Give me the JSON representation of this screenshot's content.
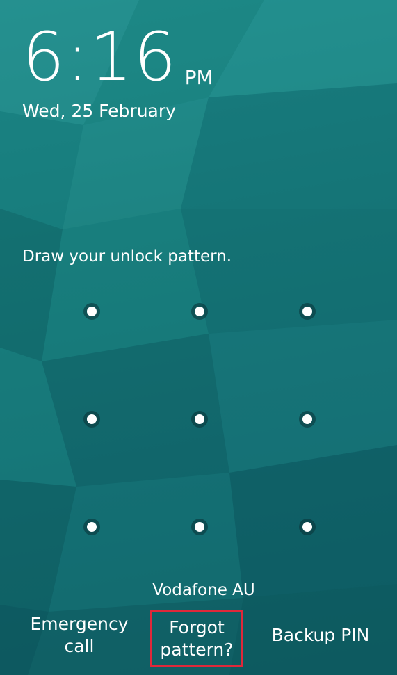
{
  "clock": {
    "time": "6:16",
    "ampm": "PM",
    "date": "Wed, 25 February"
  },
  "lock": {
    "instruction": "Draw your unlock pattern."
  },
  "carrier": "Vodafone AU",
  "bottom_actions": {
    "emergency_line1": "Emergency",
    "emergency_line2": "call",
    "forgot_line1": "Forgot",
    "forgot_line2": "pattern?",
    "backup": "Backup PIN"
  },
  "colors": {
    "highlight_border": "#e0283a",
    "background": "#167878"
  }
}
